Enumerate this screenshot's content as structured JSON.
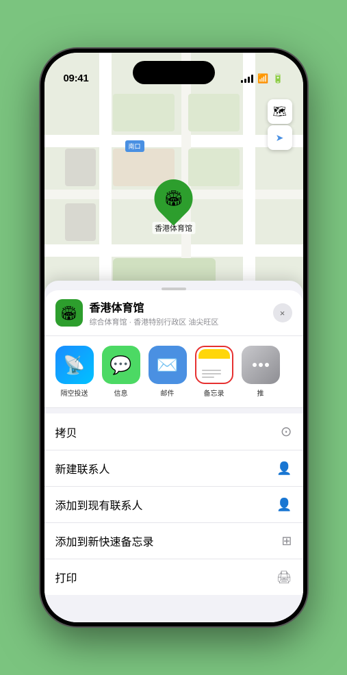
{
  "statusBar": {
    "time": "09:41",
    "signalLabel": "signal",
    "wifiLabel": "wifi",
    "batteryLabel": "battery"
  },
  "map": {
    "label": "南口",
    "stadiumName": "香港体育馆",
    "controls": {
      "mapTypeIcon": "🗺",
      "locationIcon": "➤"
    }
  },
  "venueBar": {
    "name": "香港体育馆",
    "subtitle": "综合体育馆 · 香港特别行政区 油尖旺区",
    "closeLabel": "×"
  },
  "shareRow": {
    "items": [
      {
        "id": "airdrop",
        "label": "隔空投送",
        "type": "airdrop"
      },
      {
        "id": "message",
        "label": "信息",
        "type": "message"
      },
      {
        "id": "mail",
        "label": "邮件",
        "type": "mail"
      },
      {
        "id": "notes",
        "label": "备忘录",
        "type": "notes"
      },
      {
        "id": "more",
        "label": "推",
        "type": "more"
      }
    ]
  },
  "actionList": {
    "items": [
      {
        "id": "copy",
        "label": "拷贝",
        "icon": "⊙"
      },
      {
        "id": "new-contact",
        "label": "新建联系人",
        "icon": "👤"
      },
      {
        "id": "add-contact",
        "label": "添加到现有联系人",
        "icon": "👤"
      },
      {
        "id": "add-notes",
        "label": "添加到新快速备忘录",
        "icon": "⊞"
      },
      {
        "id": "print",
        "label": "打印",
        "icon": "🖨"
      }
    ]
  }
}
